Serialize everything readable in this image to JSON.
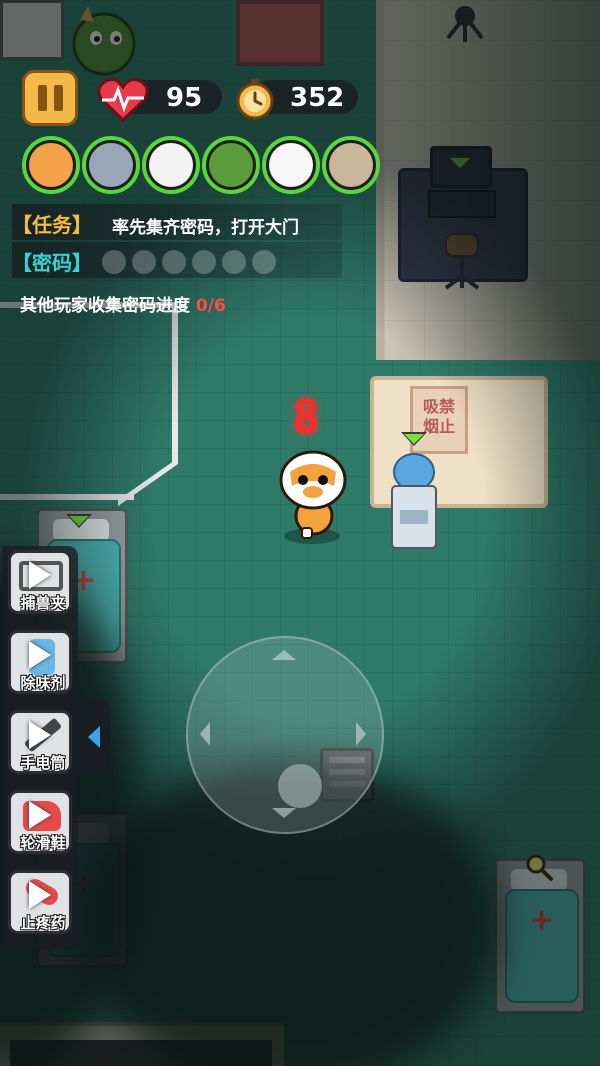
{
  "hud": {
    "health": "95",
    "coins": "352",
    "task_tag": "【任务】",
    "task_text": "率先集齐密码，打开大门",
    "password_tag": "【密码】",
    "password_slots_total": 6,
    "password_slots_filled": 0,
    "progress_label": "其他玩家收集密码进度",
    "progress_value": "0/6"
  },
  "players": [
    {
      "name": "tiger-avatar",
      "color": "#f3a24a"
    },
    {
      "name": "wolf-avatar",
      "color": "#9aa6b8"
    },
    {
      "name": "chicken-avatar",
      "color": "#f2f2f2"
    },
    {
      "name": "dragon-avatar",
      "color": "#5a9c3c"
    },
    {
      "name": "cow-avatar",
      "color": "#f6f6f6"
    },
    {
      "name": "mummy-avatar",
      "color": "#c8b79b"
    }
  ],
  "countdown": "8",
  "scene": {
    "sign_text": "吸禁\n烟止"
  },
  "tools": [
    {
      "label": "捕兽夹",
      "icon": "trap-icon"
    },
    {
      "label": "除味剂",
      "icon": "spray-icon"
    },
    {
      "label": "手电筒",
      "icon": "flashlight-icon"
    },
    {
      "label": "轮滑鞋",
      "icon": "rollerskate-icon"
    },
    {
      "label": "止疼药",
      "icon": "painkiller-icon"
    }
  ],
  "colors": {
    "accent_green": "#59d63d",
    "task_tag": "#f5b94a",
    "password_tag": "#3ad1d1",
    "progress_red": "#ff4d4d",
    "countdown_red": "#ff2a2a"
  }
}
